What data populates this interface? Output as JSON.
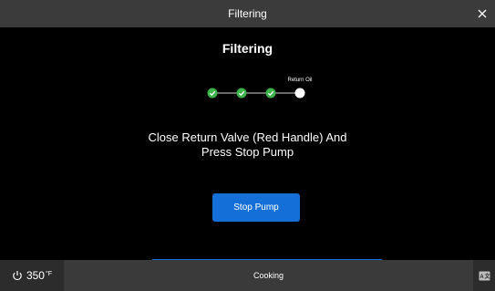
{
  "titlebar": {
    "title": "Filtering",
    "close_icon": "close-icon"
  },
  "main": {
    "heading": "Filtering",
    "steps": [
      {
        "state": "done",
        "label": ""
      },
      {
        "state": "done",
        "label": ""
      },
      {
        "state": "done",
        "label": ""
      },
      {
        "state": "current",
        "label": "Return Oil"
      }
    ],
    "instruction_line1": "Close Return Valve (Red Handle) And",
    "instruction_line2": "Press Stop Pump",
    "button_label": "Stop Pump"
  },
  "bottombar": {
    "temperature": "350",
    "temperature_unit": "°F",
    "status": "Cooking",
    "power_icon": "power-icon",
    "translate_icon": "translate-icon"
  },
  "colors": {
    "accent": "#1470d6",
    "step_done": "#3bb54a",
    "titlebar_bg": "#3b3b3b",
    "bottombar_bg": "#3a3a3a"
  }
}
